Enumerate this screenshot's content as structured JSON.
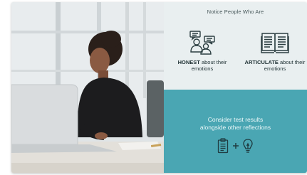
{
  "top_panel": {
    "title": "Notice People Who Are",
    "features": [
      {
        "icon": "people-chat-icon",
        "strong": "HONEST",
        "rest": " about their emotions"
      },
      {
        "icon": "open-book-icon",
        "strong": "ARTICULATE",
        "rest": " about their emotions"
      }
    ]
  },
  "bottom_panel": {
    "line1": "Consider test results",
    "line2": "alongside other reflections",
    "icons": [
      "clipboard-icon",
      "plus-icon",
      "lightbulb-icon"
    ]
  },
  "colors": {
    "teal_panel": "#4aa6b3",
    "light_panel": "#e9eff0",
    "icon_stroke": "#2a3d40"
  },
  "photo": {
    "subject": "photo of a woman looking intently at a laptop screen"
  }
}
